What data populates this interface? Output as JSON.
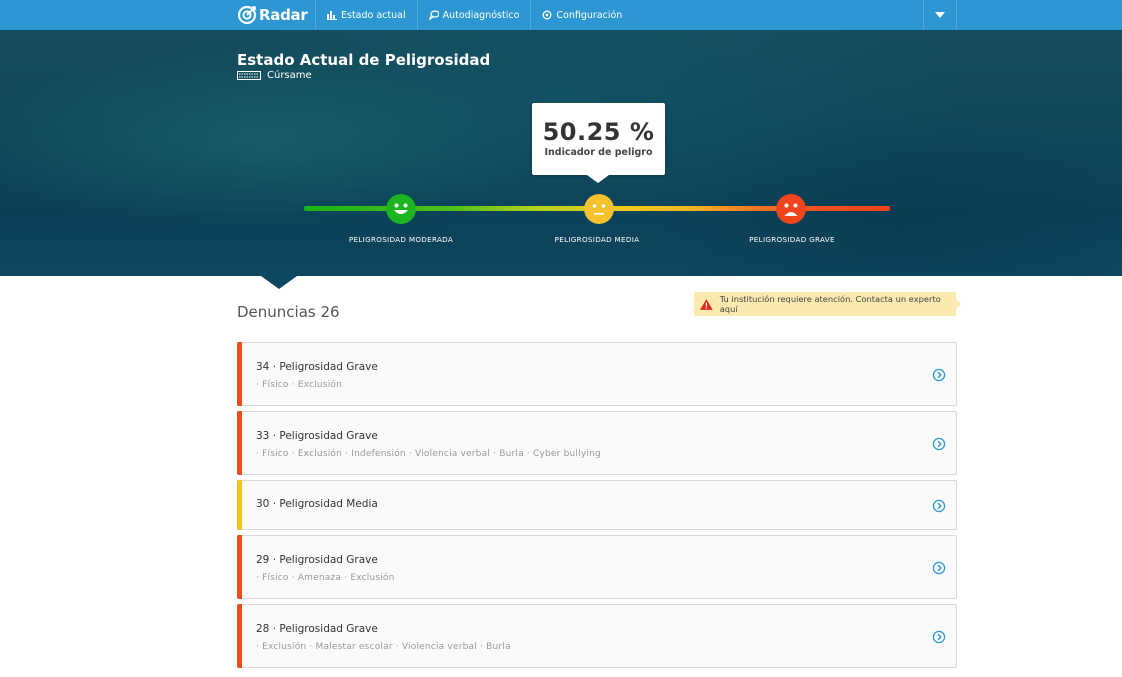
{
  "nav": {
    "brand": "Radar",
    "links": [
      {
        "label": "Estado actual",
        "icon": "bar-chart-icon"
      },
      {
        "label": "Autodiagnóstico",
        "icon": "chat-bubbles-icon"
      },
      {
        "label": "Configuración",
        "icon": "gear-icon"
      }
    ],
    "dropdown_icon": "caret-down-icon",
    "color": "#2d97d3"
  },
  "hero": {
    "title": "Estado Actual de Peligrosidad",
    "school": "Cúrsame",
    "indicator_value": "50.25 %",
    "indicator_label": "Indicador de peligro",
    "levels": [
      {
        "label": "PELIGROSIDAD MODERADA",
        "color": "#1db51f",
        "face": "happy"
      },
      {
        "label": "PELIGROSIDAD MEDIA",
        "color": "#f5c12c",
        "face": "neutral"
      },
      {
        "label": "PELIGROSIDAD GRAVE",
        "color": "#f0441d",
        "face": "sad"
      }
    ],
    "indicator_fraction": 0.5025
  },
  "content": {
    "title": "Denuncias 26",
    "alert": "Tu institución requiere atención. Contacta un experto aquí",
    "reports": [
      {
        "title": "34 · Peligrosidad Grave",
        "tags": "· Físico · Exclusión",
        "level": "grave"
      },
      {
        "title": "33 · Peligrosidad Grave",
        "tags": "· Físico · Exclusión · Indefensión · Violencia verbal · Burla · Cyber bullying",
        "level": "grave"
      },
      {
        "title": "30 · Peligrosidad Media",
        "tags": "",
        "level": "media"
      },
      {
        "title": "29 · Peligrosidad Grave",
        "tags": "· Físico · Amenaza · Exclusión",
        "level": "grave"
      },
      {
        "title": "28 · Peligrosidad Grave",
        "tags": "· Exclusión · Malestar escolar · Violencia verbal · Burla",
        "level": "grave"
      }
    ],
    "level_colors": {
      "grave": "#f04b1b",
      "media": "#f3c21f"
    }
  }
}
